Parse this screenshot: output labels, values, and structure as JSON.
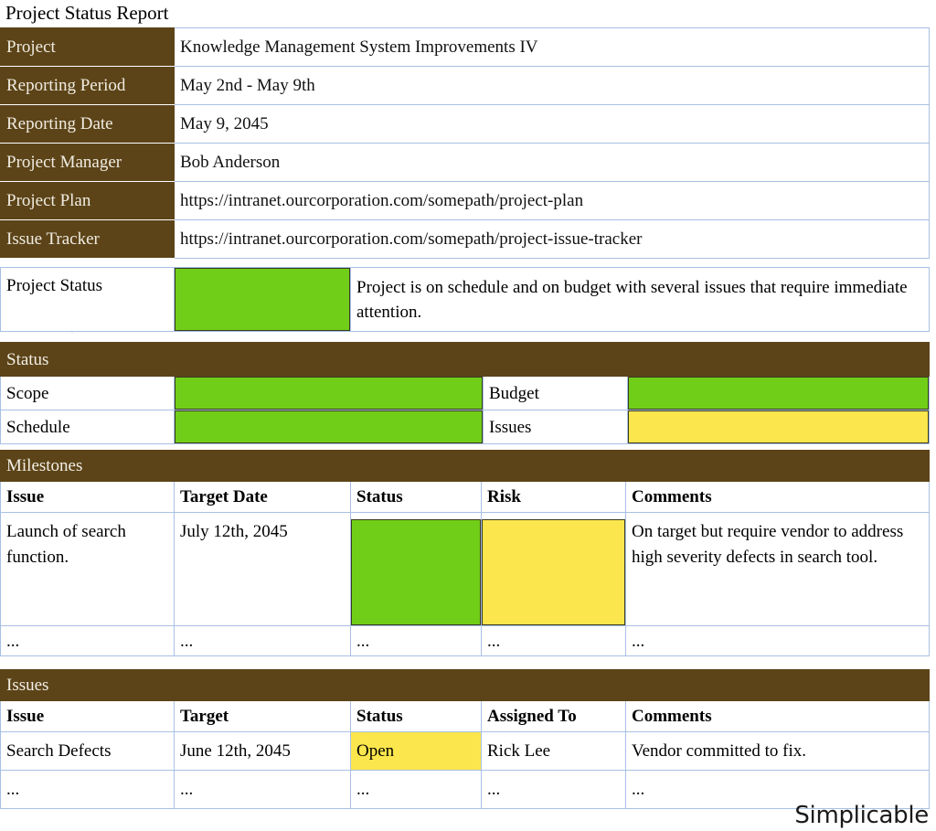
{
  "document": {
    "title": "Project Status Report",
    "brand": "Simplicable",
    "watermark": "Simplicable"
  },
  "colors": {
    "header_brown": "#5c4418",
    "green": "#71ce18",
    "yellow": "#fbe64d",
    "grid_border": "#a8c0e4"
  },
  "info": {
    "rows": [
      {
        "label": "Project",
        "value": "Knowledge Management System Improvements IV"
      },
      {
        "label": "Reporting Period",
        "value": "May 2nd - May 9th"
      },
      {
        "label": "Reporting Date",
        "value": "May 9, 2045"
      },
      {
        "label": "Project Manager",
        "value": "Bob Anderson"
      },
      {
        "label": "Project Plan",
        "value": "https://intranet.ourcorporation.com/somepath/project-plan"
      },
      {
        "label": "Issue Tracker",
        "value": "https://intranet.ourcorporation.com/somepath/project-issue-tracker"
      }
    ]
  },
  "project_status": {
    "label": "Project Status",
    "indicator_color": "green",
    "description": "Project is on schedule and on budget with several issues that require immediate attention."
  },
  "status_section": {
    "heading": "Status",
    "items": [
      {
        "label": "Scope",
        "color": "green"
      },
      {
        "label": "Budget",
        "color": "green"
      },
      {
        "label": "Schedule",
        "color": "green"
      },
      {
        "label": "Issues",
        "color": "yellow"
      }
    ]
  },
  "milestones_section": {
    "heading": "Milestones",
    "columns": [
      "Issue",
      "Target Date",
      "Status",
      "Risk",
      "Comments"
    ],
    "rows": [
      {
        "issue": "Launch of search function.",
        "target_date": "July 12th, 2045",
        "status_color": "green",
        "risk_color": "yellow",
        "comments": "On target but require vendor to address high severity defects in search tool."
      },
      {
        "issue": "...",
        "target_date": "...",
        "status_color": "none",
        "status_text": "...",
        "risk_color": "none",
        "risk_text": "...",
        "comments": "..."
      }
    ]
  },
  "issues_section": {
    "heading": "Issues",
    "columns": [
      "Issue",
      "Target",
      "Status",
      "Assigned To",
      "Comments"
    ],
    "rows": [
      {
        "issue": "Search Defects",
        "target": "June 12th, 2045",
        "status": "Open",
        "status_color": "yellow",
        "assigned_to": "Rick Lee",
        "comments": "Vendor committed to fix."
      },
      {
        "issue": "...",
        "target": "...",
        "status": "...",
        "status_color": "none",
        "assigned_to": "...",
        "comments": "..."
      }
    ]
  }
}
